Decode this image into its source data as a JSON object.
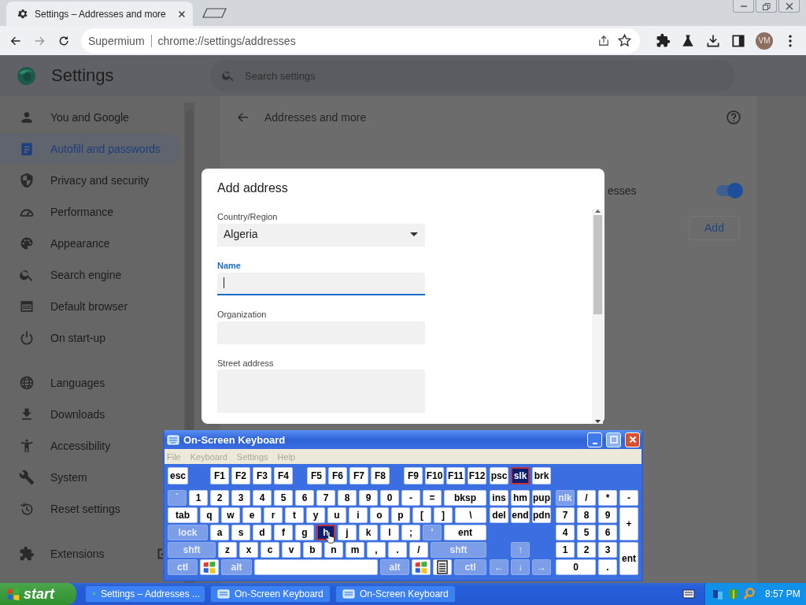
{
  "browser_tab": {
    "title": "Settings – Addresses and more"
  },
  "omnibox": {
    "site": "Supermium",
    "url": "chrome://settings/addresses"
  },
  "profile": {
    "initials": "VM"
  },
  "settings": {
    "title": "Settings",
    "search": {
      "placeholder": "Search settings"
    }
  },
  "sidebar": {
    "groups": [
      {
        "items": [
          {
            "label": "You and Google",
            "selected": false
          },
          {
            "label": "Autofill and passwords",
            "selected": true
          },
          {
            "label": "Privacy and security",
            "selected": false
          },
          {
            "label": "Performance",
            "selected": false
          },
          {
            "label": "Appearance",
            "selected": false
          },
          {
            "label": "Search engine",
            "selected": false
          },
          {
            "label": "Default browser",
            "selected": false
          },
          {
            "label": "On start-up",
            "selected": false
          }
        ]
      },
      {
        "items": [
          {
            "label": "Languages",
            "selected": false
          },
          {
            "label": "Downloads",
            "selected": false
          },
          {
            "label": "Accessibility",
            "selected": false
          },
          {
            "label": "System",
            "selected": false
          },
          {
            "label": "Reset settings",
            "selected": false
          }
        ]
      },
      {
        "items": [
          {
            "label": "Extensions",
            "selected": false
          }
        ]
      }
    ]
  },
  "page": {
    "title": "Addresses and more",
    "setting": {
      "label": "esses",
      "on": true
    },
    "add_button": "Add"
  },
  "dialog": {
    "title": "Add address",
    "fields": [
      {
        "label": "Country/Region",
        "kind": "select",
        "value": "Algeria",
        "focused": false
      },
      {
        "label": "Name",
        "kind": "text",
        "focused": true
      },
      {
        "label": "Organization",
        "kind": "text",
        "focused": false
      },
      {
        "label": "Street address",
        "kind": "textarea",
        "focused": false
      }
    ]
  },
  "keyboard": {
    "title": "On-Screen Keyboard",
    "menu": [
      {
        "label": "File",
        "disabled": true
      },
      {
        "label": "Keyboard",
        "disabled": true
      },
      {
        "label": "Settings",
        "disabled": true
      },
      {
        "label": "Help",
        "disabled": true
      }
    ],
    "function_keys": [
      {
        "label": "esc",
        "kind": "key",
        "pressed": false
      },
      {
        "label": "F1",
        "kind": "key",
        "pressed": false
      },
      {
        "label": "F2",
        "kind": "key",
        "pressed": false
      },
      {
        "label": "F3",
        "kind": "key",
        "pressed": false
      },
      {
        "label": "F4",
        "kind": "key",
        "pressed": false
      },
      {
        "label": "F5",
        "kind": "key",
        "pressed": false
      },
      {
        "label": "F6",
        "kind": "key",
        "pressed": false
      },
      {
        "label": "F7",
        "kind": "key",
        "pressed": false
      },
      {
        "label": "F8",
        "kind": "key",
        "pressed": false
      },
      {
        "label": "F9",
        "kind": "key",
        "pressed": false
      },
      {
        "label": "F10",
        "kind": "key",
        "pressed": false
      },
      {
        "label": "F11",
        "kind": "key",
        "pressed": false
      },
      {
        "label": "F12",
        "kind": "key",
        "pressed": false
      }
    ],
    "number_row": [
      {
        "label": "`",
        "kind": "mod",
        "pressed": false
      },
      {
        "label": "1",
        "kind": "key",
        "pressed": false
      },
      {
        "label": "2",
        "kind": "key",
        "pressed": false
      },
      {
        "label": "3",
        "kind": "key",
        "pressed": false
      },
      {
        "label": "4",
        "kind": "key",
        "pressed": false
      },
      {
        "label": "5",
        "kind": "key",
        "pressed": false
      },
      {
        "label": "6",
        "kind": "key",
        "pressed": false
      },
      {
        "label": "7",
        "kind": "key",
        "pressed": false
      },
      {
        "label": "8",
        "kind": "key",
        "pressed": false
      },
      {
        "label": "9",
        "kind": "key",
        "pressed": false
      },
      {
        "label": "0",
        "kind": "key",
        "pressed": false
      },
      {
        "label": "-",
        "kind": "key",
        "pressed": false
      },
      {
        "label": "=",
        "kind": "key",
        "pressed": false
      },
      {
        "label": "bksp",
        "kind": "key",
        "pressed": false
      }
    ],
    "qwerty_row": [
      {
        "label": "tab",
        "kind": "key",
        "pressed": false
      },
      {
        "label": "q",
        "kind": "key",
        "pressed": false
      },
      {
        "label": "w",
        "kind": "key",
        "pressed": false
      },
      {
        "label": "e",
        "kind": "key",
        "pressed": false
      },
      {
        "label": "r",
        "kind": "key",
        "pressed": false
      },
      {
        "label": "t",
        "kind": "key",
        "pressed": false
      },
      {
        "label": "y",
        "kind": "key",
        "pressed": false
      },
      {
        "label": "u",
        "kind": "key",
        "pressed": false
      },
      {
        "label": "i",
        "kind": "key",
        "pressed": false
      },
      {
        "label": "o",
        "kind": "key",
        "pressed": false
      },
      {
        "label": "p",
        "kind": "key",
        "pressed": false
      },
      {
        "label": "[",
        "kind": "key",
        "pressed": false
      },
      {
        "label": "]",
        "kind": "key",
        "pressed": false
      },
      {
        "label": "\\",
        "kind": "key",
        "pressed": false
      }
    ],
    "home_row": [
      {
        "label": "lock",
        "kind": "mod",
        "pressed": false
      },
      {
        "label": "a",
        "kind": "key",
        "pressed": false
      },
      {
        "label": "s",
        "kind": "key",
        "pressed": false
      },
      {
        "label": "d",
        "kind": "key",
        "pressed": false
      },
      {
        "label": "f",
        "kind": "key",
        "pressed": false
      },
      {
        "label": "g",
        "kind": "key",
        "pressed": false
      },
      {
        "label": "h",
        "kind": "key",
        "pressed": true
      },
      {
        "label": "j",
        "kind": "key",
        "pressed": false
      },
      {
        "label": "k",
        "kind": "key",
        "pressed": false
      },
      {
        "label": "l",
        "kind": "key",
        "pressed": false
      },
      {
        "label": ";",
        "kind": "key",
        "pressed": false
      },
      {
        "label": "'",
        "kind": "mod",
        "pressed": false
      },
      {
        "label": "ent",
        "kind": "key",
        "pressed": false
      }
    ],
    "shift_row": [
      {
        "label": "shft",
        "kind": "mod",
        "pressed": false
      },
      {
        "label": "z",
        "kind": "key",
        "pressed": false
      },
      {
        "label": "x",
        "kind": "key",
        "pressed": false
      },
      {
        "label": "c",
        "kind": "key",
        "pressed": false
      },
      {
        "label": "v",
        "kind": "key",
        "pressed": false
      },
      {
        "label": "b",
        "kind": "key",
        "pressed": false
      },
      {
        "label": "n",
        "kind": "key",
        "pressed": false
      },
      {
        "label": "m",
        "kind": "key",
        "pressed": false
      },
      {
        "label": ",",
        "kind": "key",
        "pressed": false
      },
      {
        "label": ".",
        "kind": "key",
        "pressed": false
      },
      {
        "label": "/",
        "kind": "key",
        "pressed": false
      },
      {
        "label": "shft",
        "kind": "mod",
        "pressed": false
      }
    ],
    "bottom_row": [
      {
        "label": "ctl",
        "kind": "mod",
        "pressed": false
      },
      {
        "kind": "windows",
        "pressed": false
      },
      {
        "label": "alt",
        "kind": "mod",
        "pressed": false
      },
      {
        "kind": "space",
        "pressed": false
      },
      {
        "label": "alt",
        "kind": "mod",
        "pressed": false
      },
      {
        "kind": "windows",
        "pressed": false
      },
      {
        "kind": "menu",
        "pressed": false
      },
      {
        "label": "ctl",
        "kind": "mod",
        "pressed": false
      }
    ],
    "nav_keys": [
      {
        "label": "psc",
        "kind": "key",
        "pressed": false
      },
      {
        "label": "slk",
        "kind": "key",
        "pressed": true
      },
      {
        "label": "brk",
        "kind": "key",
        "pressed": false
      },
      {
        "label": "ins",
        "kind": "key",
        "pressed": false
      },
      {
        "label": "hm",
        "kind": "key",
        "pressed": false
      },
      {
        "label": "pup",
        "kind": "key",
        "pressed": false
      },
      {
        "label": "del",
        "kind": "key",
        "pressed": false
      },
      {
        "label": "end",
        "kind": "key",
        "pressed": false
      },
      {
        "label": "pdn",
        "kind": "key",
        "pressed": false
      },
      {
        "label": "↑",
        "kind": "mod",
        "pressed": false
      },
      {
        "label": "←",
        "kind": "mod",
        "pressed": false
      },
      {
        "label": "↓",
        "kind": "mod",
        "pressed": false
      },
      {
        "label": "→",
        "kind": "mod",
        "pressed": false
      }
    ],
    "numpad_keys": [
      {
        "label": "nlk",
        "kind": "mod",
        "pressed": false
      },
      {
        "label": "/",
        "kind": "key",
        "pressed": false
      },
      {
        "label": "*",
        "kind": "key",
        "pressed": false
      },
      {
        "label": "-",
        "kind": "key",
        "pressed": false
      },
      {
        "label": "7",
        "kind": "key",
        "pressed": false
      },
      {
        "label": "8",
        "kind": "key",
        "pressed": false
      },
      {
        "label": "9",
        "kind": "key",
        "pressed": false
      },
      {
        "label": "+",
        "kind": "key",
        "pressed": false
      },
      {
        "label": "4",
        "kind": "key",
        "pressed": false
      },
      {
        "label": "5",
        "kind": "key",
        "pressed": false
      },
      {
        "label": "6",
        "kind": "key",
        "pressed": false
      },
      {
        "label": "1",
        "kind": "key",
        "pressed": false
      },
      {
        "label": "2",
        "kind": "key",
        "pressed": false
      },
      {
        "label": "3",
        "kind": "key",
        "pressed": false
      },
      {
        "label": "ent",
        "kind": "key",
        "pressed": false
      },
      {
        "label": "0",
        "kind": "key",
        "pressed": false
      },
      {
        "label": ".",
        "kind": "key",
        "pressed": false
      }
    ]
  },
  "taskbar": {
    "start": "start",
    "buttons": [
      {
        "label": "Settings – Addresses ...",
        "kind": "browser"
      },
      {
        "label": "On-Screen Keyboard",
        "kind": "keyboard"
      },
      {
        "label": "On-Screen Keyboard",
        "kind": "keyboard"
      }
    ],
    "clock": "8:57 PM"
  }
}
